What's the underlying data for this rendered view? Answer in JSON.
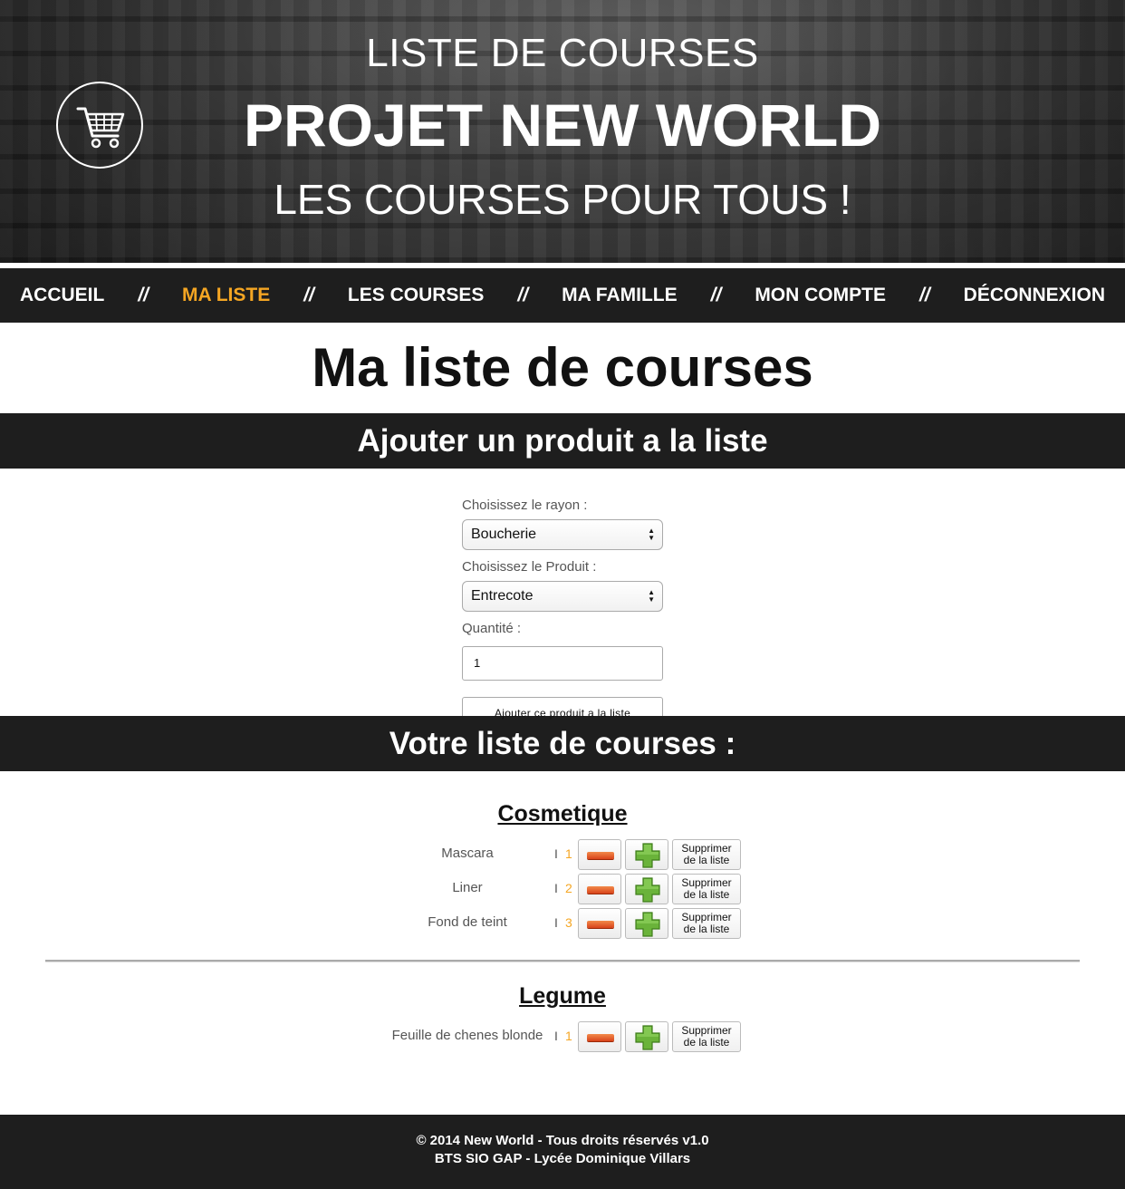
{
  "header": {
    "line1": "LISTE DE COURSES",
    "line2": "PROJET NEW WORLD",
    "line3": "LES COURSES POUR TOUS !",
    "logo_icon": "shopping-cart-icon"
  },
  "nav": {
    "items": [
      "ACCUEIL",
      "MA LISTE",
      "LES COURSES",
      "MA FAMILLE",
      "MON COMPTE",
      "DÉCONNEXION"
    ],
    "separator": "//",
    "active_index": 1,
    "active_color": "#f5a623"
  },
  "page_title": "Ma liste de courses",
  "add_section": {
    "title": "Ajouter un produit a la liste",
    "rayon_label": "Choisissez le rayon :",
    "rayon_value": "Boucherie",
    "produit_label": "Choisissez le Produit :",
    "produit_value": "Entrecote",
    "quantite_label": "Quantité :",
    "quantite_value": "1",
    "submit_label": "Ajouter ce produit a la liste"
  },
  "list_section": {
    "title": "Votre liste de courses :",
    "separator_char": "I",
    "delete_line1": "Supprimer",
    "delete_line2": "de la liste",
    "categories": [
      {
        "name": "Cosmetique",
        "items": [
          {
            "name": "Mascara",
            "qty": "1"
          },
          {
            "name": "Liner",
            "qty": "2"
          },
          {
            "name": "Fond de teint",
            "qty": "3"
          }
        ]
      },
      {
        "name": "Legume",
        "items": [
          {
            "name": "Feuille de chenes blonde",
            "qty": "1"
          }
        ]
      }
    ]
  },
  "footer": {
    "line1": "© 2014 New World - Tous droits réservés v1.0",
    "line2": "BTS SIO GAP - Lycée Dominique Villars"
  }
}
